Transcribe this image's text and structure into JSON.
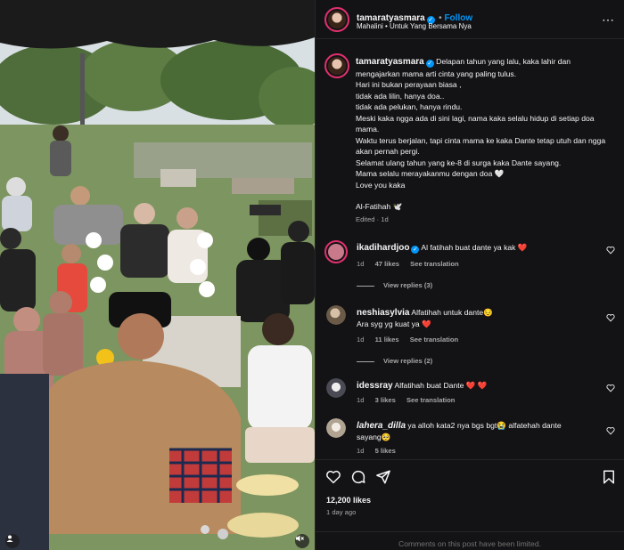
{
  "post": {
    "username": "tamaratyasmara",
    "follow_label": "Follow",
    "audio": "Mahalini • Untuk Yang Bersama Nya"
  },
  "caption": {
    "username": "tamaratyasmara",
    "lines": [
      "Delapan tahun yang lalu, kaka lahir dan mengajarkan mama arti cinta yang paling tulus.",
      "Hari ini bukan perayaan biasa ,",
      "tidak ada lilin, hanya doa..",
      "tidak ada pelukan, hanya rindu.",
      "Meski kaka ngga ada di sini lagi, nama kaka selalu hidup di setiap doa mama.",
      "Waktu terus berjalan, tapi cinta mama ke kaka Dante tetap utuh dan ngga akan pernah pergi.",
      "Selamat ulang tahun yang ke-8 di surga kaka Dante sayang.",
      "Mama selalu merayakanmu dengan doa 🤍",
      "Love you kaka"
    ],
    "closing": "Al-Fatihah 🕊️",
    "edited": "Edited · 1d"
  },
  "comments": [
    {
      "username": "ikadihardjoo",
      "verified": true,
      "text": "Al fatihah buat dante ya kak ❤️",
      "time": "1d",
      "likes": "47 likes",
      "translate": "See translation",
      "replies": "View replies (3)",
      "avatar_color": "#c97a8a"
    },
    {
      "username": "neshiasylvia",
      "verified": false,
      "text": "Alfatihah untuk dante😔",
      "text2": "Ara syg yg kuat ya ❤️",
      "time": "1d",
      "likes": "11 likes",
      "translate": "See translation",
      "replies": "View replies (2)",
      "avatar_color": "#8a7660"
    },
    {
      "username": "idessray",
      "verified": false,
      "text": "Alfatihah buat Dante ❤️ ❤️",
      "time": "1d",
      "likes": "3 likes",
      "translate": "See translation",
      "avatar_color": "#b8b8c2"
    },
    {
      "username": "lahera_dilla",
      "verified": false,
      "text": "ya alloh kata2 nya bgs bgt😭  alfatehah dante sayang🥺",
      "time": "1d",
      "likes": "5 likes",
      "avatar_color": "#c9c0b4"
    }
  ],
  "footer": {
    "likes": "12,200 likes",
    "time_ago": "1 day ago",
    "limited": "Comments on this post have been limited."
  },
  "colors": {
    "accent": "#0095f6",
    "heart": "#ff3040",
    "bg": "#131316"
  },
  "icons": [
    "verified-icon",
    "heart-icon",
    "comment-icon",
    "share-icon",
    "bookmark-icon",
    "mute-icon",
    "user-tag-icon"
  ]
}
